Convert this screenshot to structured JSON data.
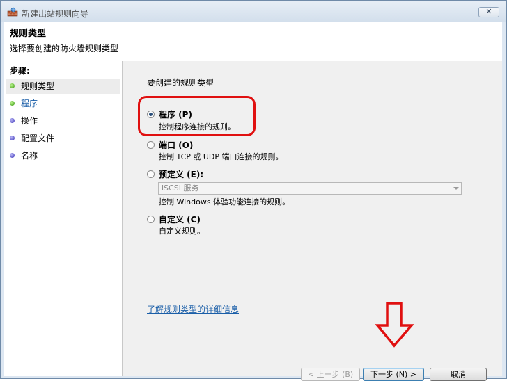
{
  "window": {
    "title": "新建出站规则向导",
    "close_label": "✕"
  },
  "header": {
    "title": "规则类型",
    "subtitle": "选择要创建的防火墙规则类型"
  },
  "steps": {
    "heading": "步骤:",
    "items": [
      {
        "label": "规则类型",
        "state": "current",
        "color": "#3b9a12"
      },
      {
        "label": "程序",
        "state": "next",
        "color": "#3b9a12"
      },
      {
        "label": "操作",
        "state": "pending",
        "color": "#3c35b8"
      },
      {
        "label": "配置文件",
        "state": "pending",
        "color": "#3c35b8"
      },
      {
        "label": "名称",
        "state": "pending",
        "color": "#3c35b8"
      }
    ]
  },
  "main": {
    "prompt": "要创建的规则类型",
    "options": [
      {
        "title": "程序 (P)",
        "desc": "控制程序连接的规则。",
        "checked": true
      },
      {
        "title": "端口 (O)",
        "desc": "控制 TCP 或 UDP 端口连接的规则。",
        "checked": false
      },
      {
        "title": "预定义 (E):",
        "desc": "控制 Windows 体验功能连接的规则。",
        "checked": false
      },
      {
        "title": "自定义 (C)",
        "desc": "自定义规则。",
        "checked": false
      }
    ],
    "predefined_select": {
      "value": "iSCSI 服务",
      "enabled": false
    },
    "learn_more": "了解规则类型的详细信息"
  },
  "buttons": {
    "back": "< 上一步 (B)",
    "next": "下一步 (N) >",
    "cancel": "取消"
  },
  "annotations": {
    "highlight_color": "#e01010"
  }
}
